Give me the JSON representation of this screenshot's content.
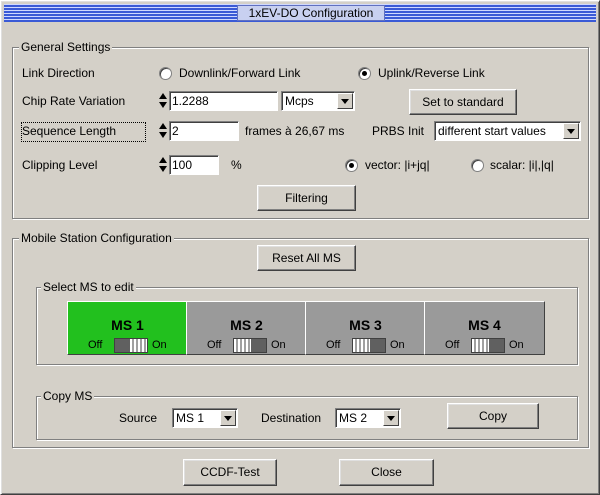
{
  "window": {
    "title": "1xEV-DO Configuration"
  },
  "general": {
    "legend": "General Settings",
    "link_direction_label": "Link Direction",
    "downlink_label": "Downlink/Forward Link",
    "uplink_label": "Uplink/Reverse Link",
    "link_direction_selected": "uplink",
    "chip_rate_label": "Chip Rate Variation",
    "chip_rate_value": "1.2288",
    "chip_rate_unit": "Mcps",
    "set_to_standard_label": "Set to standard",
    "sequence_length_label": "Sequence Length",
    "sequence_length_value": "2",
    "frames_label": "frames à 26,67 ms",
    "prbs_label": "PRBS Init",
    "prbs_value": "different start values",
    "clipping_label": "Clipping Level",
    "clipping_value": "100",
    "clipping_unit": "%",
    "vector_label": "vector: |i+jq|",
    "scalar_label": "scalar: |i|,|q|",
    "clipping_mode_selected": "vector",
    "filtering_label": "Filtering"
  },
  "mobile": {
    "legend": "Mobile Station Configuration",
    "reset_all_label": "Reset All MS",
    "select_legend": "Select MS to edit",
    "stations": [
      {
        "name": "MS 1",
        "off": "Off",
        "on": "On",
        "active": true
      },
      {
        "name": "MS 2",
        "off": "Off",
        "on": "On",
        "active": false
      },
      {
        "name": "MS 3",
        "off": "Off",
        "on": "On",
        "active": false
      },
      {
        "name": "MS 4",
        "off": "Off",
        "on": "On",
        "active": false
      }
    ],
    "copy_legend": "Copy MS",
    "source_label": "Source",
    "source_value": "MS 1",
    "destination_label": "Destination",
    "destination_value": "MS 2",
    "copy_label": "Copy"
  },
  "footer": {
    "ccdf_label": "CCDF-Test",
    "close_label": "Close"
  },
  "colors": {
    "active_ms": "#22c01e",
    "inactive_ms": "#9a9a9a",
    "title_bar": "#3a5ad6"
  }
}
